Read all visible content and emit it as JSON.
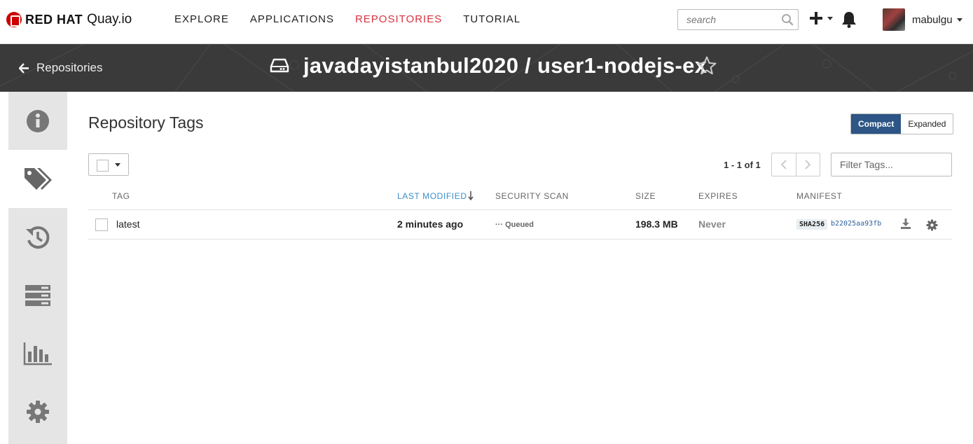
{
  "nav": {
    "brand": "RED HAT",
    "product": "Quay.io",
    "links": [
      {
        "label": "EXPLORE",
        "active": false
      },
      {
        "label": "APPLICATIONS",
        "active": false
      },
      {
        "label": "REPOSITORIES",
        "active": true
      },
      {
        "label": "TUTORIAL",
        "active": false
      }
    ],
    "search_placeholder": "search",
    "username": "mabulgu"
  },
  "header": {
    "back_label": "Repositories",
    "repo_title": "javadayistanbul2020 / user1-nodejs-ex"
  },
  "sidebar": {
    "items": [
      {
        "icon": "info-icon",
        "active": false
      },
      {
        "icon": "tags-icon",
        "active": true
      },
      {
        "icon": "history-icon",
        "active": false
      },
      {
        "icon": "builds-icon",
        "active": false
      },
      {
        "icon": "usage-logs-icon",
        "active": false
      },
      {
        "icon": "settings-icon",
        "active": false
      }
    ]
  },
  "main": {
    "title": "Repository Tags",
    "view_toggle": {
      "compact": "Compact",
      "expanded": "Expanded",
      "selected": "Compact"
    },
    "pagination": "1 - 1 of 1",
    "filter_placeholder": "Filter Tags...",
    "columns": {
      "tag": "TAG",
      "last_modified": "LAST MODIFIED",
      "security_scan": "SECURITY SCAN",
      "size": "SIZE",
      "expires": "EXPIRES",
      "manifest": "MANIFEST"
    },
    "rows": [
      {
        "tag": "latest",
        "last_modified": "2 minutes ago",
        "security_scan": "Queued",
        "size": "198.3 MB",
        "expires": "Never",
        "manifest_algo": "SHA256",
        "manifest_digest": "b22025aa93fb"
      }
    ]
  },
  "colors": {
    "accent_red": "#d9333f",
    "header_band": "#3a3a3a",
    "toggle_active": "#2d5585",
    "sort_link": "#3a8fc7"
  }
}
